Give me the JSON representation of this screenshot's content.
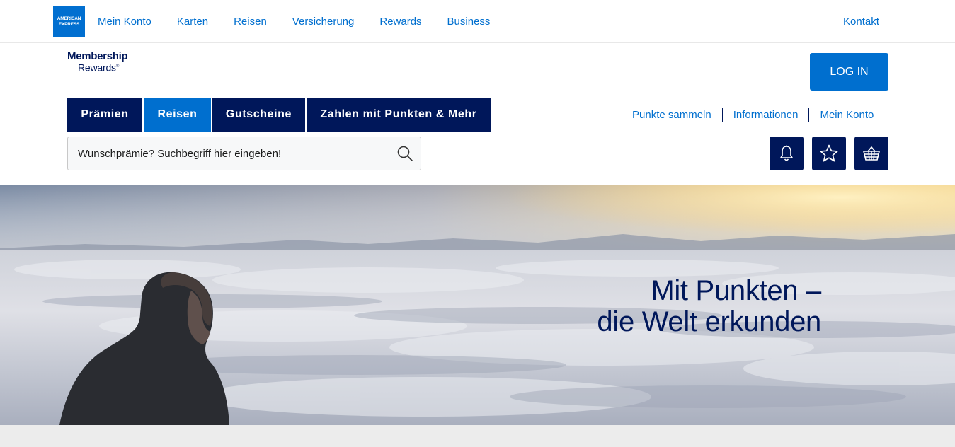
{
  "brand": {
    "amex_logo_line1": "AMERICAN",
    "amex_logo_line2": "EXPRESS",
    "mr_logo_line1": "Membership",
    "mr_logo_line2": "Rewards",
    "mr_logo_mark": "®"
  },
  "topnav": {
    "items": [
      "Mein Konto",
      "Karten",
      "Reisen",
      "Versicherung",
      "Rewards",
      "Business"
    ],
    "contact": "Kontakt"
  },
  "header": {
    "login_label": "LOG IN",
    "categories": [
      "Prämien",
      "Reisen",
      "Gutscheine",
      "Zahlen mit Punkten & Mehr"
    ],
    "active_category": "Reisen",
    "sublinks": [
      "Punkte sammeln",
      "Informationen",
      "Mein Konto"
    ],
    "search_placeholder": "Wunschprämie? Suchbegriff hier eingeben!",
    "icons": [
      "search-icon",
      "bell-icon",
      "star-icon",
      "basket-icon"
    ]
  },
  "hero": {
    "line1": "Mit Punkten –",
    "line2": "die Welt erkunden"
  },
  "colors": {
    "brand_blue": "#006fcf",
    "navy": "#00175a",
    "footer_band": "#ececec"
  }
}
